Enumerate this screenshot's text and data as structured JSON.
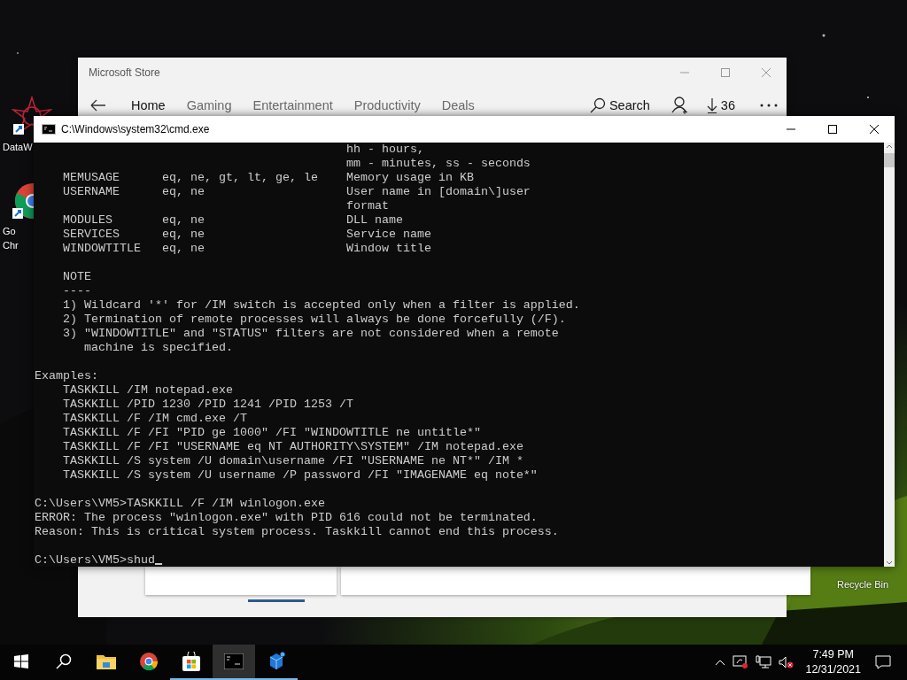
{
  "desktop_icons": [
    {
      "kind": "app",
      "label": [
        "DataW"
      ]
    },
    {
      "kind": "browser",
      "label": [
        "Go",
        "Chr"
      ]
    },
    {
      "kind": "recycle-bin",
      "label": [
        "Recycle Bin"
      ]
    }
  ],
  "store_window": {
    "title": "Microsoft Store",
    "tabs": [
      {
        "label": "Home",
        "selected": true
      },
      {
        "label": "Gaming",
        "selected": false
      },
      {
        "label": "Entertainment",
        "selected": false
      },
      {
        "label": "Productivity",
        "selected": false
      },
      {
        "label": "Deals",
        "selected": false
      }
    ],
    "search": "Search",
    "downloads": "36"
  },
  "cmd_window": {
    "title": "C:\\Windows\\system32\\cmd.exe",
    "blocks": [
      [
        "                                            hh - hours,",
        "                                            mm - minutes, ss - seconds",
        "    MEMUSAGE      eq, ne, gt, lt, ge, le    Memory usage in KB",
        "    USERNAME      eq, ne                    User name in [domain\\]user",
        "                                            format",
        "    MODULES       eq, ne                    DLL name",
        "    SERVICES      eq, ne                    Service name",
        "    WINDOWTITLE   eq, ne                    Window title"
      ],
      [
        "    NOTE",
        "    ----",
        "    1) Wildcard '*' for /IM switch is accepted only when a filter is applied.",
        "    2) Termination of remote processes will always be done forcefully (/F).",
        "    3) \"WINDOWTITLE\" and \"STATUS\" filters are not considered when a remote",
        "       machine is specified."
      ],
      [
        "Examples:",
        "    TASKKILL /IM notepad.exe",
        "    TASKKILL /PID 1230 /PID 1241 /PID 1253 /T",
        "    TASKKILL /F /IM cmd.exe /T",
        "    TASKKILL /F /FI \"PID ge 1000\" /FI \"WINDOWTITLE ne untitle*\"",
        "    TASKKILL /F /FI \"USERNAME eq NT AUTHORITY\\SYSTEM\" /IM notepad.exe",
        "    TASKKILL /S system /U domain\\username /FI \"USERNAME ne NT*\" /IM *",
        "    TASKKILL /S system /U username /P password /FI \"IMAGENAME eq note*\""
      ],
      [
        "C:\\Users\\VM5>TASKKILL /F /IM winlogon.exe",
        "ERROR: The process \"winlogon.exe\" with PID 616 could not be terminated.",
        "Reason: This is critical system process. Taskkill cannot end this process."
      ]
    ],
    "prompt": "C:\\Users\\VM5>shud"
  },
  "taskbar": {
    "apps": [
      {
        "kind": "start",
        "selected": false,
        "running": false
      },
      {
        "kind": "search",
        "selected": false,
        "running": false
      },
      {
        "kind": "folder",
        "selected": false,
        "running": false
      },
      {
        "kind": "browser",
        "selected": false,
        "running": false
      },
      {
        "kind": "store",
        "selected": false,
        "running": true
      },
      {
        "kind": "terminal",
        "selected": true,
        "running": true
      },
      {
        "kind": "app",
        "selected": false,
        "running": true
      }
    ],
    "time": "7:49 PM",
    "date": "12/31/2021"
  }
}
